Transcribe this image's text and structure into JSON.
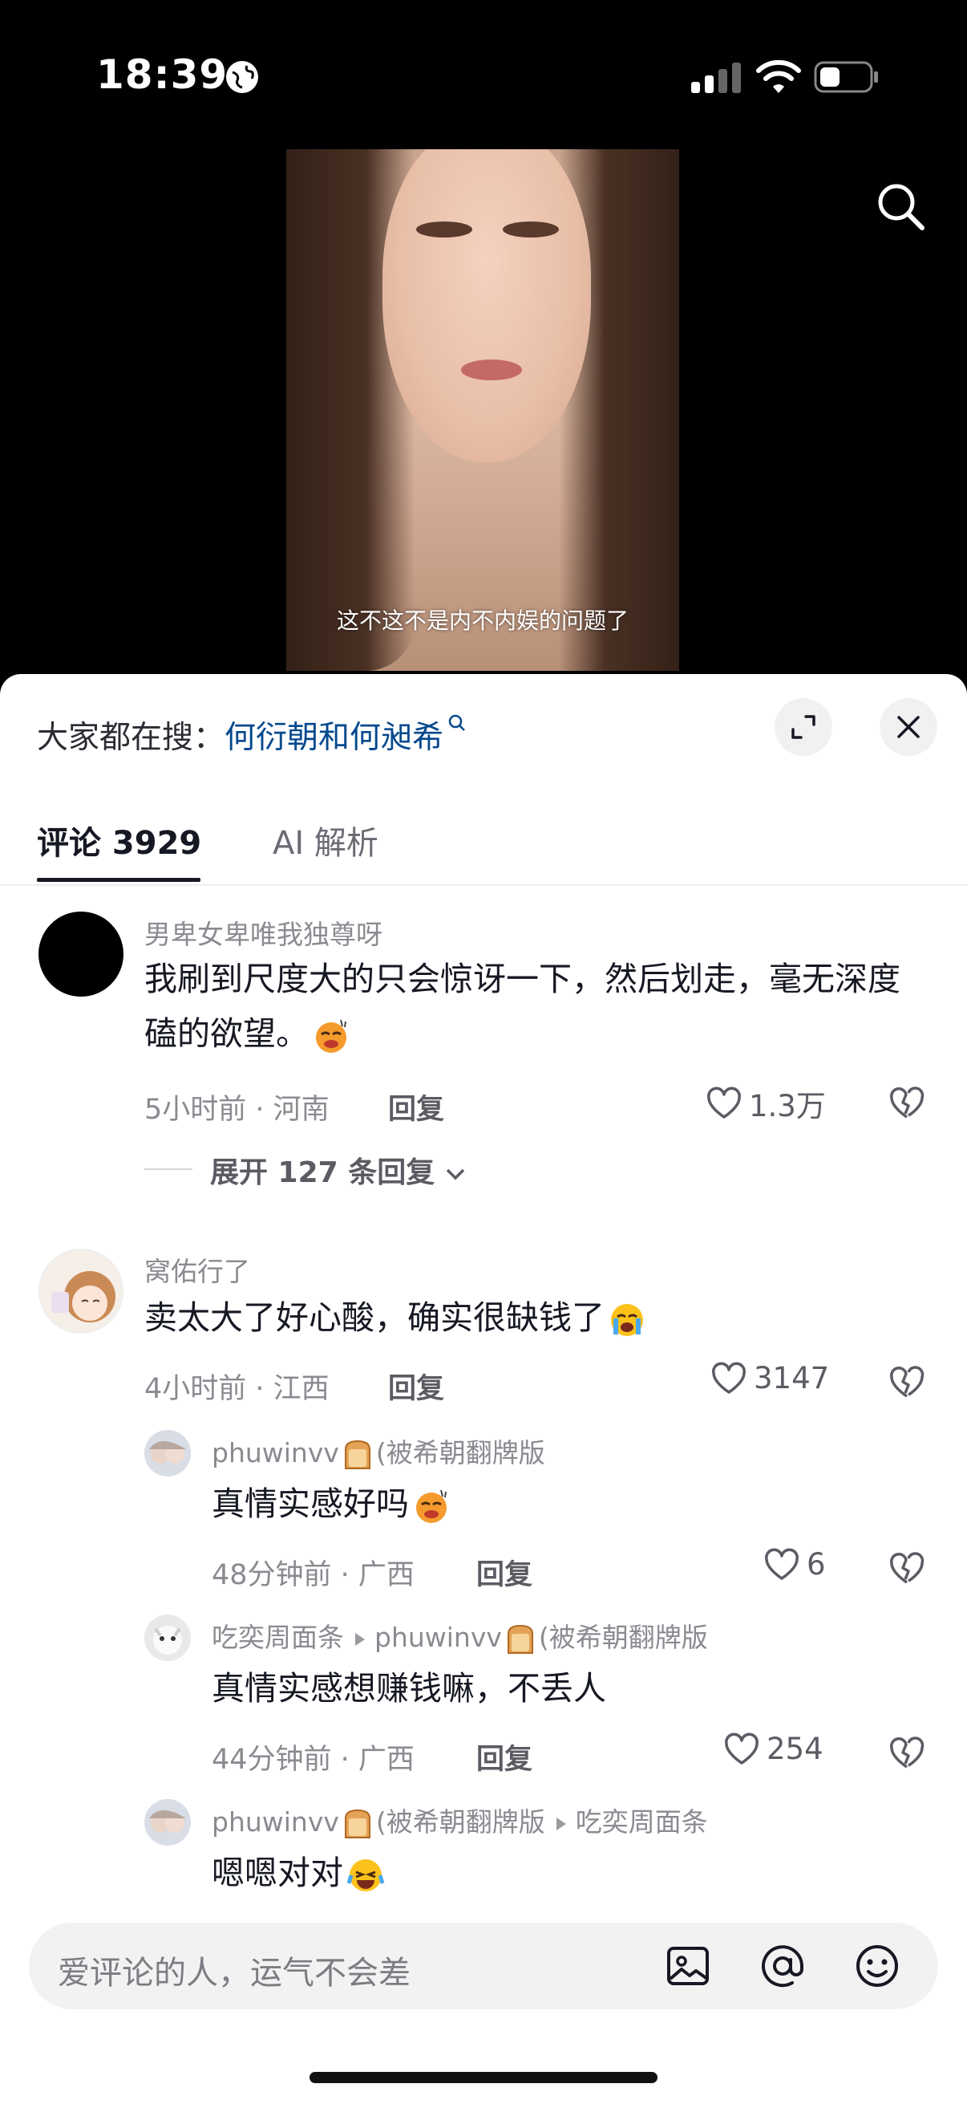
{
  "status_bar": {
    "time": "18:39"
  },
  "video": {
    "subtitle": "这不这不是内不内娱的问题了"
  },
  "trending": {
    "prefix": "大家都在搜：",
    "keyword": "何衍朝和何昶希"
  },
  "tabs": [
    {
      "label": "评论 3929"
    },
    {
      "label": "AI 解析"
    }
  ],
  "comments": [
    {
      "user": "男卑女卑唯我独尊呀",
      "text": "我刷到尺度大的只会惊讶一下，然后划走，毫无深度磕的欲望。",
      "time_location": "5小时前 · 河南",
      "reply_label": "回复",
      "likes": "1.3万",
      "expand_label": "展开 127 条回复"
    },
    {
      "user": "窝佑行了",
      "text": "卖太大了好心酸，确实很缺钱了",
      "time_location": "4小时前 · 江西",
      "reply_label": "回复",
      "likes": "3147",
      "replies": [
        {
          "user": "phuwinvv",
          "user_suffix": "(被希朝翻牌版",
          "text": "真情实感好吗",
          "time_location": "48分钟前 · 广西",
          "reply_label": "回复",
          "likes": "6"
        },
        {
          "user": "吃奕周面条",
          "reply_to": "phuwinvv",
          "reply_to_suffix": "(被希朝翻牌版",
          "text": "真情实感想赚钱嘛，不丢人",
          "time_location": "44分钟前 · 广西",
          "reply_label": "回复",
          "likes": "254"
        },
        {
          "user": "phuwinvv",
          "user_suffix": "(被希朝翻牌版",
          "reply_to": "吃奕周面条",
          "text": "嗯嗯对对"
        }
      ]
    }
  ],
  "input": {
    "placeholder": "爱评论的人，运气不会差"
  },
  "icons": [
    "globe-icon",
    "signal-icon",
    "wifi-icon",
    "battery-icon",
    "search-icon",
    "expand-icon",
    "close-icon",
    "heart-icon",
    "broken-heart-icon",
    "image-icon",
    "at-icon",
    "emoji-icon",
    "toast-icon",
    "chevron-down-icon"
  ],
  "colors": {
    "keyword": "#04498d",
    "sheet_bg": "#ffffff",
    "text": "#161823",
    "muted": "#8a8b91"
  }
}
